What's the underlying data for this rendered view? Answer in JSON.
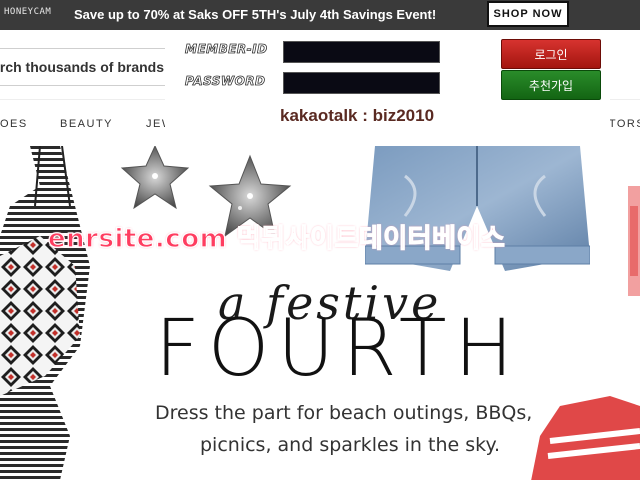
{
  "watermark": "HONEYCAM",
  "promo": {
    "text": "Save up to 70% at Saks OFF 5TH's July 4th Savings Event!",
    "button": "SHOP NOW"
  },
  "search": {
    "value": "rch thousands of brands"
  },
  "login": {
    "member_id_label": "MEMBER-ID",
    "password_label": "PASSWORD",
    "login_button": "로그인",
    "join_button": "추천가입",
    "contact": "kakaotalk : biz2010"
  },
  "nav": {
    "items": [
      "OES",
      "BEAUTY",
      "JEWELRY",
      "EDITORS"
    ]
  },
  "overlay_watermark": "enrsite.com 먹튀사이트데이터베이스",
  "hero": {
    "script_line": "a festive",
    "headline": "FOURTH",
    "subline_1": "Dress the part for beach outings, BBQs,",
    "subline_2": "picnics, and sparkles in the sky."
  },
  "colors": {
    "promo_bg": "#3a3a3a",
    "login_red": "#c1231f",
    "join_green": "#1f7a1f",
    "watermark_pink": "#ff3d60",
    "kakao_brown": "#5a2a22"
  }
}
